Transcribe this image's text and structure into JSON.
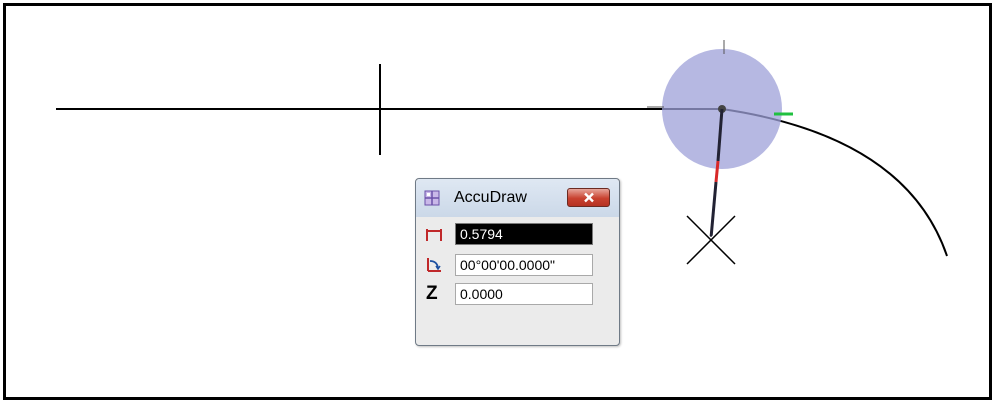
{
  "accudraw": {
    "title": "AccuDraw",
    "distance_value": "0.5794",
    "angle_value": "00°00'00.0000\"",
    "z_label": "Z",
    "z_value": "0.0000"
  },
  "icons": {
    "title": "accudraw-icon",
    "close": "close-icon",
    "distance": "distance-icon",
    "angle": "angle-icon"
  },
  "colors": {
    "compass_fill": "#9da0d8",
    "accent_red": "#d82828",
    "accent_green": "#20c040",
    "close_button": "#c8412f"
  }
}
